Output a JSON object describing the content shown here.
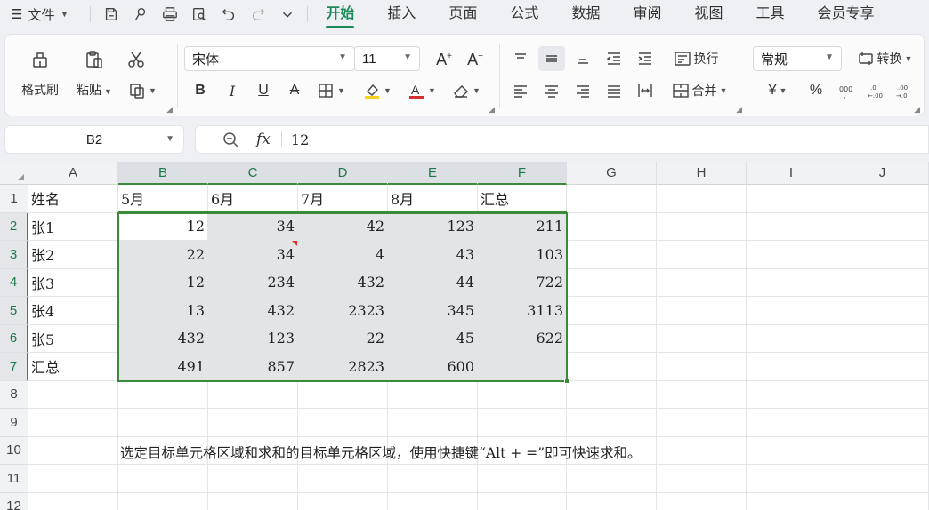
{
  "menubar": {
    "file_menu": "文件",
    "tabs": [
      {
        "label": "开始",
        "active": true
      },
      {
        "label": "插入",
        "active": false
      },
      {
        "label": "页面",
        "active": false
      },
      {
        "label": "公式",
        "active": false
      },
      {
        "label": "数据",
        "active": false
      },
      {
        "label": "审阅",
        "active": false
      },
      {
        "label": "视图",
        "active": false
      },
      {
        "label": "工具",
        "active": false
      },
      {
        "label": "会员专享",
        "active": false
      }
    ]
  },
  "ribbon": {
    "format_painter": "格式刷",
    "paste": "粘贴",
    "font_name": "宋体",
    "font_size": "11",
    "wrap_text": "换行",
    "merge": "合并",
    "number_format": "常规",
    "convert": "转换",
    "currency_symbol": "¥",
    "percent_symbol": "%"
  },
  "formula_bar": {
    "name_box": "B2",
    "fx_label": "fx",
    "value": "12"
  },
  "sheet": {
    "columns": [
      "A",
      "B",
      "C",
      "D",
      "E",
      "F",
      "G",
      "H",
      "I",
      "J"
    ],
    "rows": [
      "1",
      "2",
      "3",
      "4",
      "5",
      "6",
      "7",
      "8",
      "9",
      "10",
      "11",
      "12"
    ],
    "header_row": [
      "姓名",
      "5月",
      "6月",
      "7月",
      "8月",
      "汇总"
    ],
    "data": [
      [
        "张1",
        "12",
        "34",
        "42",
        "123",
        "211"
      ],
      [
        "张2",
        "22",
        "34",
        "4",
        "43",
        "103"
      ],
      [
        "张3",
        "12",
        "234",
        "432",
        "44",
        "722"
      ],
      [
        "张4",
        "13",
        "432",
        "2323",
        "345",
        "3113"
      ],
      [
        "张5",
        "432",
        "123",
        "22",
        "45",
        "622"
      ],
      [
        "汇总",
        "491",
        "857",
        "2823",
        "600",
        ""
      ]
    ],
    "note": "选定目标单元格区域和求和的目标单元格区域，使用快捷键“Alt + =”即可快速求和。",
    "selection_color": "#3a8a3a",
    "accent_color": "#1b8a5a"
  }
}
